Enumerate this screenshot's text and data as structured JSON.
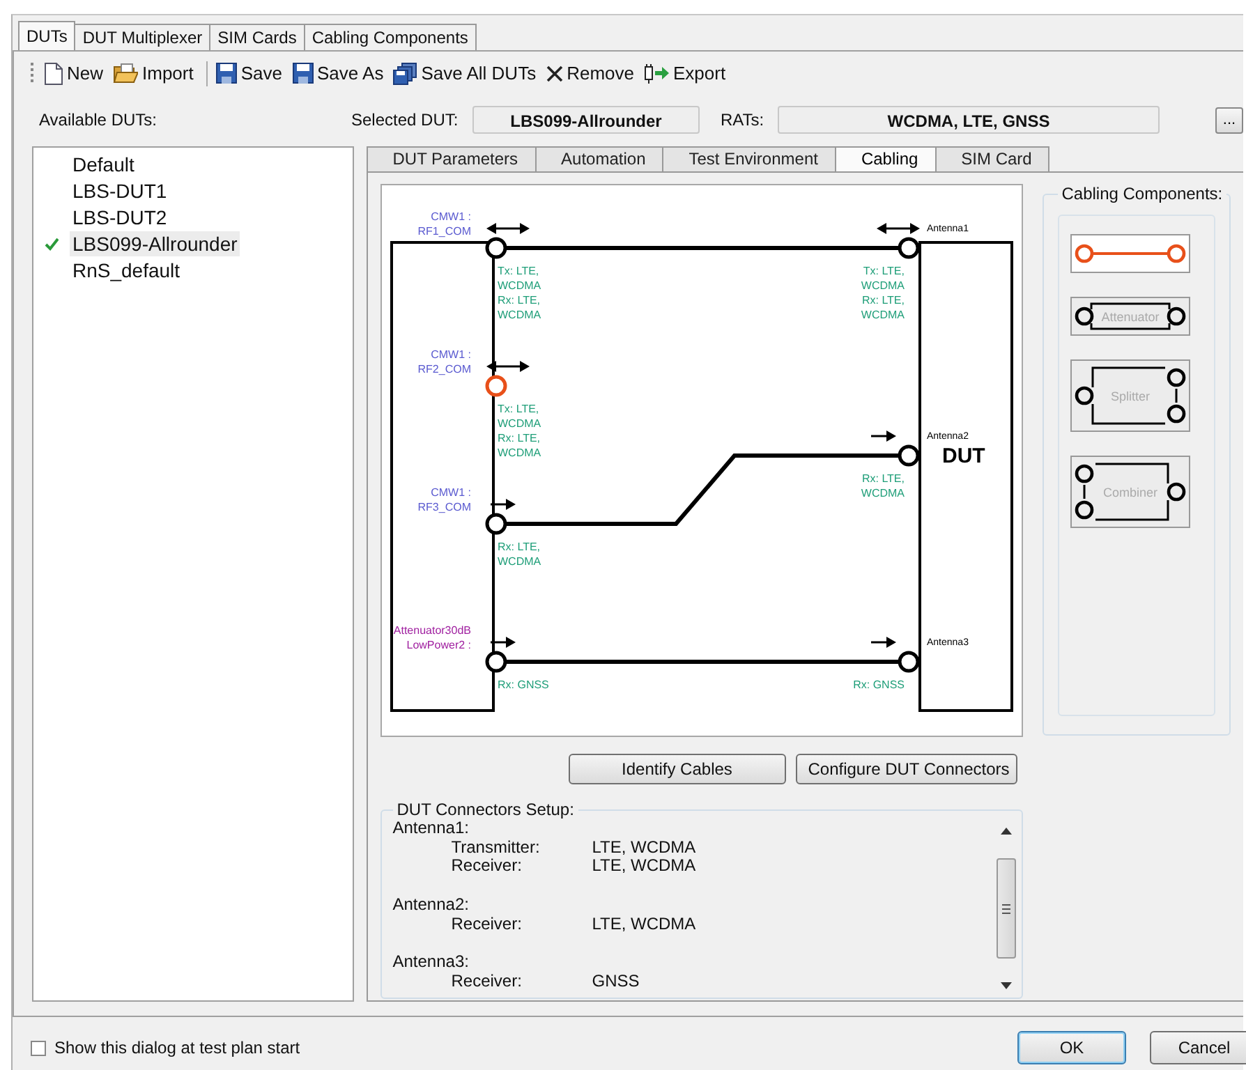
{
  "top_tabs": [
    {
      "label": "DUTs",
      "selected": true
    },
    {
      "label": "DUT Multiplexer",
      "selected": false
    },
    {
      "label": "SIM Cards",
      "selected": false
    },
    {
      "label": "Cabling Components",
      "selected": false
    }
  ],
  "toolbar": [
    {
      "kind": "button",
      "label": "New"
    },
    {
      "kind": "button",
      "label": "Import"
    },
    {
      "kind": "separator"
    },
    {
      "kind": "button",
      "label": "Save"
    },
    {
      "kind": "button",
      "label": "Save As"
    },
    {
      "kind": "button",
      "label": "Save All DUTs"
    },
    {
      "kind": "button",
      "label": "Remove"
    },
    {
      "kind": "button",
      "label": "Export"
    }
  ],
  "available_duts": {
    "label": "Available DUTs:",
    "items": [
      {
        "name": "Default",
        "selected": false,
        "checked": false
      },
      {
        "name": "LBS-DUT1",
        "selected": false,
        "checked": false
      },
      {
        "name": "LBS-DUT2",
        "selected": false,
        "checked": false
      },
      {
        "name": "LBS099-Allrounder",
        "selected": true,
        "checked": true
      },
      {
        "name": "RnS_default",
        "selected": false,
        "checked": false
      }
    ]
  },
  "selected_dut": {
    "label": "Selected DUT:",
    "value": "LBS099-Allrounder"
  },
  "rats": {
    "label": "RATs:",
    "value": "WCDMA, LTE, GNSS",
    "button": "..."
  },
  "tabs": [
    {
      "label": "DUT Parameters",
      "selected": false
    },
    {
      "label": "Automation",
      "selected": false
    },
    {
      "label": "Test Environment",
      "selected": false
    },
    {
      "label": "Cabling",
      "selected": true
    },
    {
      "label": "SIM Card",
      "selected": false
    }
  ],
  "cabling_diagram": {
    "host_ports": [
      {
        "label": [
          "CMW1 :",
          "RF1_COM"
        ],
        "color": "#5a5ad0",
        "kind": "bidirectional",
        "signals": [
          "Tx: LTE,",
          "WCDMA",
          "Rx: LTE,",
          "WCDMA"
        ],
        "selected": false,
        "connected": true
      },
      {
        "label": [
          "CMW1 :",
          "RF2_COM"
        ],
        "color": "#5a5ad0",
        "kind": "bidirectional",
        "signals": [
          "Tx: LTE,",
          "WCDMA",
          "Rx: LTE,",
          "WCDMA"
        ],
        "selected": true,
        "connected": false
      },
      {
        "label": [
          "CMW1 :",
          "RF3_COM"
        ],
        "color": "#5a5ad0",
        "kind": "transmit",
        "signals": [
          "Rx: LTE,",
          "WCDMA"
        ],
        "selected": false,
        "connected": true
      },
      {
        "label": [
          "Attenuator30dB",
          "LowPower2 :"
        ],
        "color": "#a020a0",
        "kind": "transmit",
        "signals": [
          "Rx: GNSS"
        ],
        "selected": false,
        "connected": true
      }
    ],
    "dut": {
      "label": "DUT",
      "antennas": [
        {
          "label": "Antenna1",
          "kind": "bidirectional",
          "signals": [
            "Tx: LTE,",
            "WCDMA",
            "Rx: LTE,",
            "WCDMA"
          ]
        },
        {
          "label": "Antenna2",
          "kind": "transmit",
          "signals": [
            "Rx: LTE,",
            "WCDMA"
          ]
        },
        {
          "label": "Antenna3",
          "kind": "transmit",
          "signals": [
            "Rx: GNSS"
          ]
        }
      ]
    }
  },
  "actions": [
    "Identify Cables",
    "Configure DUT Connectors"
  ],
  "connectors_setup": {
    "title": "DUT Connectors Setup:",
    "antennas": [
      {
        "name": "Antenna1:",
        "entries": [
          {
            "role": "Transmitter:",
            "rats": "LTE, WCDMA"
          },
          {
            "role": "Receiver:",
            "rats": "LTE, WCDMA"
          }
        ]
      },
      {
        "name": "Antenna2:",
        "entries": [
          {
            "role": "Receiver:",
            "rats": "LTE, WCDMA"
          }
        ]
      },
      {
        "name": "Antenna3:",
        "entries": [
          {
            "role": "Receiver:",
            "rats": "GNSS"
          }
        ]
      }
    ]
  },
  "cabling_components": {
    "title": "Cabling Components:",
    "items": [
      {
        "kind": "cable",
        "selected": true
      },
      {
        "kind": "attenuator",
        "label": "Attenuator",
        "selected": false
      },
      {
        "kind": "splitter",
        "label": "Splitter",
        "selected": false
      },
      {
        "kind": "combiner",
        "label": "Combiner",
        "selected": false
      }
    ]
  },
  "show_at_start": {
    "label": "Show this dialog at test plan start",
    "checked": false
  },
  "buttons": [
    {
      "label": "OK",
      "default": true
    },
    {
      "label": "Cancel",
      "default": false
    }
  ]
}
